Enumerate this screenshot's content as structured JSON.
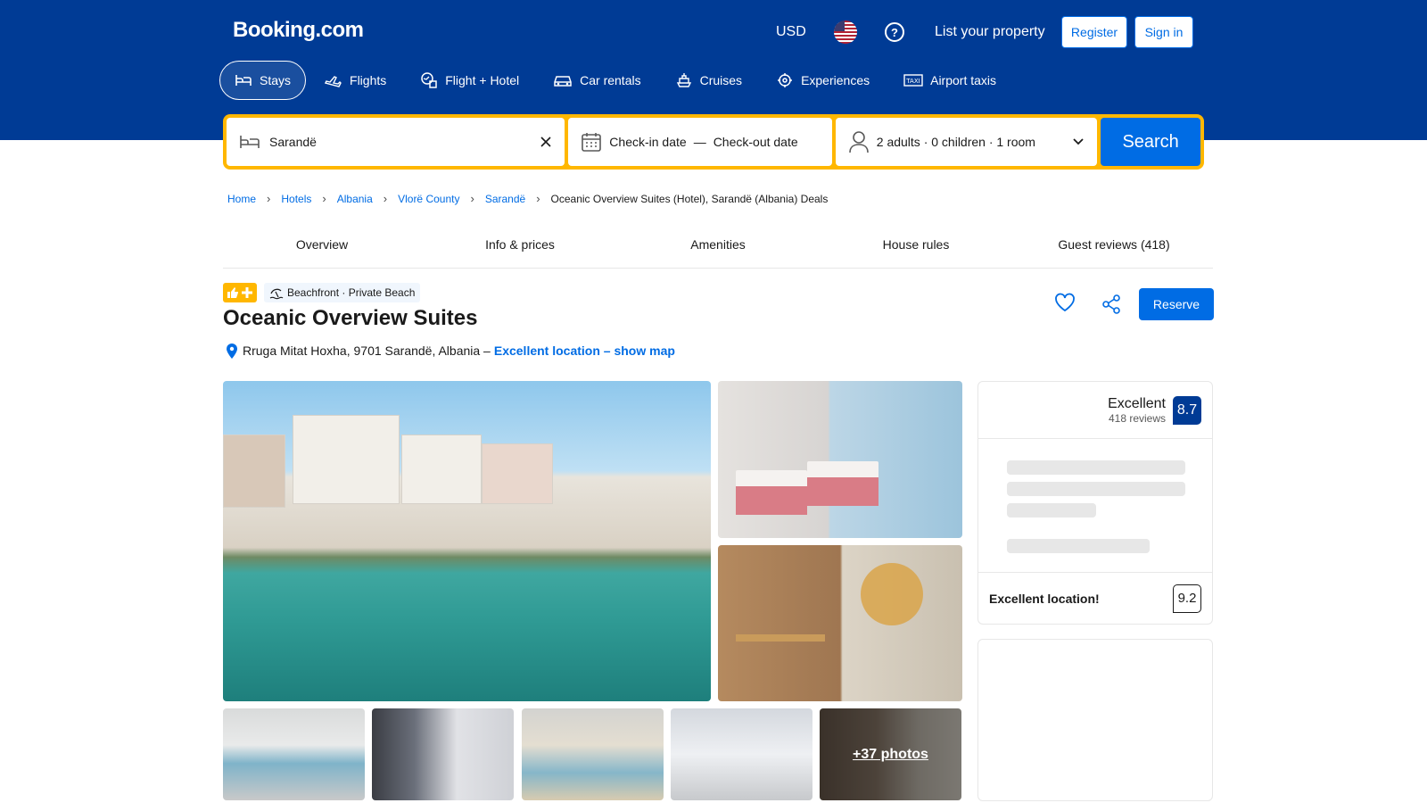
{
  "header": {
    "logo": "Booking.com",
    "currency": "USD",
    "list_property": "List your property",
    "register": "Register",
    "sign_in": "Sign in"
  },
  "nav": [
    {
      "label": "Stays",
      "icon": "bed-icon",
      "active": true
    },
    {
      "label": "Flights",
      "icon": "plane-icon"
    },
    {
      "label": "Flight + Hotel",
      "icon": "flight-hotel-icon"
    },
    {
      "label": "Car rentals",
      "icon": "car-icon"
    },
    {
      "label": "Cruises",
      "icon": "ship-icon"
    },
    {
      "label": "Experiences",
      "icon": "attraction-icon"
    },
    {
      "label": "Airport taxis",
      "icon": "taxi-icon"
    }
  ],
  "search": {
    "destination": "Sarandë",
    "checkin": "Check-in date",
    "dash": "—",
    "checkout": "Check-out date",
    "guests": "2 adults · 0 children · 1 room",
    "button": "Search"
  },
  "breadcrumb": {
    "items": [
      "Home",
      "Hotels",
      "Albania",
      "Vlorë County",
      "Sarandë"
    ],
    "current": "Oceanic Overview Suites (Hotel), Sarandë (Albania) Deals"
  },
  "tabs": [
    "Overview",
    "Info & prices",
    "Amenities",
    "House rules",
    "Guest reviews (418)"
  ],
  "property": {
    "badge": "Beachfront · Private Beach",
    "name": "Oceanic Overview Suites",
    "address": "Rruga Mitat Hoxha, 9701 Sarandë, Albania –",
    "address_link": "Excellent location – show map",
    "reserve": "Reserve"
  },
  "gallery": {
    "more_photos": "+37 photos"
  },
  "review": {
    "word": "Excellent",
    "count": "418 reviews",
    "score": "8.7",
    "location_label": "Excellent location!",
    "location_score": "9.2"
  },
  "colors": {
    "brand": "#003b95",
    "accent": "#006ce4",
    "highlight": "#ffb700"
  }
}
